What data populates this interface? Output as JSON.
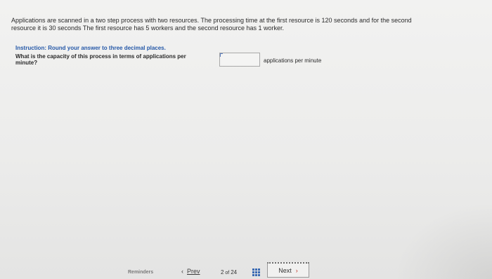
{
  "question": {
    "text": "Applications are scanned in a two step process with two resources. The processing time at the first resource is 120 seconds and for the second resource it is 30 seconds The first resource has 5 workers and the second resource has 1 worker."
  },
  "instruction": {
    "label": "Instruction:",
    "text": "Round your answer to three decimal places."
  },
  "prompt": {
    "text": "What is the capacity of this process in terms of applications per minute?"
  },
  "answer": {
    "value": "",
    "unit": "applications per minute"
  },
  "footer": {
    "reminders_label": "Reminders",
    "prev_label": "Prev",
    "prev_chevron": "‹",
    "page_current": "2",
    "page_of": "of",
    "page_total": "24",
    "next_label": "Next",
    "next_chevron": "›",
    "grid_icon": "grid-icon"
  },
  "colors": {
    "accent_blue": "#2558a8",
    "next_chevron": "#c0392b"
  }
}
